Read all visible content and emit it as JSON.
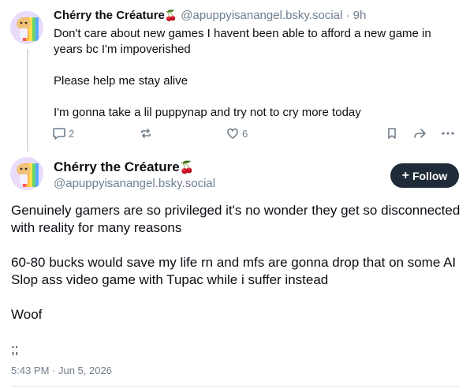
{
  "parent_post": {
    "author_name": "Chérry the Créature",
    "author_emoji": "🍒",
    "handle": "@apuppyisanangel.bsky.social",
    "separator": "·",
    "time": "9h",
    "lines": [
      "Don't care about new games I havent been able to afford a new game in years bc I'm impoverished",
      "Please help me stay alive",
      "I'm gonna take a lil puppynap and try not to cry more today"
    ],
    "reply_count": "2",
    "like_count": "6",
    "icons": [
      "reply-icon",
      "repost-icon",
      "like-icon",
      "bookmark-icon",
      "share-icon",
      "more-icon"
    ]
  },
  "main_post": {
    "author_name": "Chérry the Créature",
    "author_emoji": "🍒",
    "handle": "@apuppyisanangel.bsky.social",
    "follow_label": "Follow",
    "paragraphs": [
      "Genuinely gamers are so privileged it's no wonder they get so disconnected with reality for many reasons",
      "60-80 bucks would save my life rn and mfs are gonna drop that on some AI Slop ass video game with Tupac while i suffer instead",
      "Woof",
      ";;"
    ],
    "timestamp": "5:43 PM · Jun 5, 2026"
  },
  "colors": {
    "text": "#0b0f14",
    "muted": "#6f7d8c",
    "follow_bg": "#1f2b38",
    "thread_line": "#d4dbe2",
    "cherry": "#c8102e"
  }
}
